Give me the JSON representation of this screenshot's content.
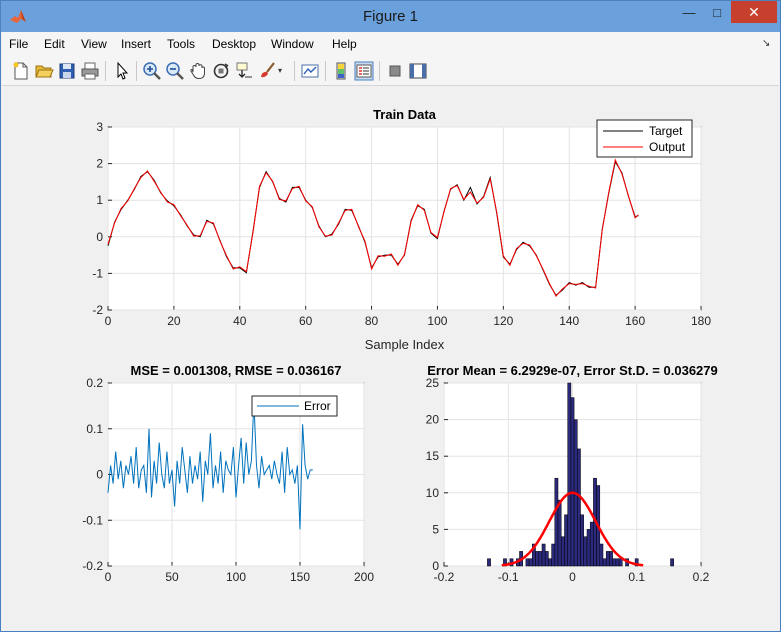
{
  "window": {
    "title": "Figure 1",
    "minimize": "—",
    "maximize": "□",
    "close": "✕"
  },
  "colors": {
    "titlebar": "#6aa0dc",
    "close": "#c7402e",
    "target": "#000000",
    "output": "#ff0000",
    "error": "#0072bd",
    "hist_bar": "#2b2a7d",
    "fit": "#ff0000"
  },
  "menu": [
    "File",
    "Edit",
    "View",
    "Insert",
    "Tools",
    "Desktop",
    "Window",
    "Help"
  ],
  "toolbar": [
    "new-figure-icon",
    "open-file-icon",
    "save-icon",
    "print-icon",
    "pointer-icon",
    "zoom-in-icon",
    "zoom-out-icon",
    "pan-icon",
    "rotate-3d-icon",
    "data-cursor-icon",
    "brush-icon",
    "link-plot-icon",
    "colorbar-icon",
    "legend-icon",
    "hide-plot-tools-icon",
    "show-plot-tools-icon"
  ],
  "chart_data": [
    {
      "type": "line",
      "title": "Train Data",
      "xlabel": "Sample Index",
      "ylabel": "",
      "xlim": [
        0,
        180
      ],
      "ylim": [
        -2,
        3
      ],
      "xticks": [
        "0",
        "20",
        "40",
        "60",
        "80",
        "100",
        "120",
        "140",
        "160",
        "180"
      ],
      "yticks": [
        "-2",
        "-1",
        "0",
        "1",
        "2",
        "3"
      ],
      "legend": {
        "placement": "top-right",
        "entries": [
          "Target",
          "Output"
        ]
      },
      "grid": true,
      "series": [
        {
          "name": "Target",
          "color": "#000000",
          "x": [
            0,
            2,
            4,
            6,
            8,
            10,
            12,
            14,
            16,
            18,
            20,
            22,
            24,
            26,
            28,
            30,
            32,
            34,
            36,
            38,
            40,
            42,
            44,
            46,
            48,
            50,
            52,
            54,
            56,
            58,
            60,
            62,
            64,
            66,
            68,
            70,
            72,
            74,
            76,
            78,
            80,
            82,
            84,
            86,
            88,
            90,
            92,
            94,
            96,
            98,
            100,
            102,
            104,
            106,
            108,
            110,
            112,
            114,
            116,
            118,
            120,
            122,
            124,
            126,
            128,
            130,
            132,
            134,
            136,
            138,
            140,
            142,
            144,
            146,
            148,
            150,
            152,
            154,
            156,
            158,
            160,
            161
          ],
          "y": [
            -0.25,
            0.4,
            0.75,
            1.0,
            1.3,
            1.65,
            1.78,
            1.55,
            1.2,
            0.98,
            0.85,
            0.6,
            0.3,
            0.05,
            0.0,
            0.45,
            0.35,
            -0.1,
            -0.55,
            -0.85,
            -0.85,
            -0.98,
            0.15,
            1.35,
            1.78,
            1.5,
            1.05,
            0.95,
            1.35,
            1.35,
            1.0,
            0.8,
            0.3,
            0.0,
            0.08,
            0.35,
            0.75,
            0.72,
            0.3,
            -0.15,
            -0.85,
            -0.55,
            -0.5,
            -0.5,
            -0.75,
            -0.5,
            0.45,
            0.85,
            0.75,
            0.1,
            -0.05,
            0.7,
            1.3,
            1.42,
            1.0,
            1.35,
            0.9,
            1.1,
            1.62,
            0.65,
            -0.55,
            -0.75,
            -0.35,
            -0.15,
            -0.25,
            -0.5,
            -0.9,
            -1.3,
            -1.6,
            -1.45,
            -1.25,
            -1.32,
            -1.25,
            -1.38,
            -1.38,
            0.2,
            1.2,
            2.05,
            1.75,
            1.1,
            0.55,
            0.58
          ]
        },
        {
          "name": "Output",
          "color": "#ff0000",
          "x": [
            0,
            2,
            4,
            6,
            8,
            10,
            12,
            14,
            16,
            18,
            20,
            22,
            24,
            26,
            28,
            30,
            32,
            34,
            36,
            38,
            40,
            42,
            44,
            46,
            48,
            50,
            52,
            54,
            56,
            58,
            60,
            62,
            64,
            66,
            68,
            70,
            72,
            74,
            76,
            78,
            80,
            82,
            84,
            86,
            88,
            90,
            92,
            94,
            96,
            98,
            100,
            102,
            104,
            106,
            108,
            110,
            112,
            114,
            116,
            118,
            120,
            122,
            124,
            126,
            128,
            130,
            132,
            134,
            136,
            138,
            140,
            142,
            144,
            146,
            148,
            150,
            152,
            154,
            156,
            158,
            160,
            161
          ],
          "y": [
            -0.2,
            0.38,
            0.78,
            0.98,
            1.32,
            1.62,
            1.8,
            1.52,
            1.22,
            0.95,
            0.88,
            0.58,
            0.32,
            0.02,
            0.03,
            0.42,
            0.38,
            -0.12,
            -0.52,
            -0.88,
            -0.82,
            -0.95,
            0.12,
            1.38,
            1.75,
            1.52,
            1.02,
            0.98,
            1.32,
            1.38,
            0.98,
            0.82,
            0.28,
            0.02,
            0.05,
            0.38,
            0.72,
            0.75,
            0.28,
            -0.12,
            -0.88,
            -0.52,
            -0.53,
            -0.47,
            -0.78,
            -0.48,
            0.42,
            0.88,
            0.72,
            0.12,
            -0.02,
            0.68,
            1.32,
            1.4,
            1.02,
            1.22,
            0.92,
            1.08,
            1.58,
            0.68,
            -0.52,
            -0.78,
            -0.32,
            -0.18,
            -0.22,
            -0.52,
            -0.88,
            -1.28,
            -1.62,
            -1.42,
            -1.28,
            -1.3,
            -1.28,
            -1.35,
            -1.4,
            0.18,
            1.22,
            2.1,
            1.72,
            1.12,
            0.52,
            0.6
          ]
        }
      ]
    },
    {
      "type": "line",
      "title": "MSE = 0.001308, RMSE = 0.036167",
      "xlabel": "",
      "ylabel": "",
      "xlim": [
        0,
        200
      ],
      "ylim": [
        -0.2,
        0.2
      ],
      "xticks": [
        "0",
        "50",
        "100",
        "150",
        "200"
      ],
      "yticks": [
        "-0.2",
        "-0.1",
        "0",
        "0.1",
        "0.2"
      ],
      "legend": {
        "placement": "top-right",
        "entries": [
          "Error"
        ]
      },
      "grid": true,
      "series": [
        {
          "name": "Error",
          "color": "#0072bd",
          "x": [
            0,
            2,
            4,
            6,
            8,
            10,
            12,
            14,
            16,
            18,
            20,
            22,
            24,
            26,
            28,
            30,
            32,
            34,
            36,
            38,
            40,
            42,
            44,
            46,
            48,
            50,
            52,
            54,
            56,
            58,
            60,
            62,
            64,
            66,
            68,
            70,
            72,
            74,
            76,
            78,
            80,
            82,
            84,
            86,
            88,
            90,
            92,
            94,
            96,
            98,
            100,
            102,
            104,
            106,
            108,
            110,
            112,
            114,
            116,
            118,
            120,
            122,
            124,
            126,
            128,
            130,
            132,
            134,
            136,
            138,
            140,
            142,
            144,
            146,
            148,
            150,
            152,
            154,
            156,
            158,
            160
          ],
          "y": [
            -0.04,
            0.02,
            -0.02,
            0.05,
            -0.01,
            0.03,
            -0.03,
            0.02,
            0.0,
            0.04,
            -0.02,
            0.06,
            -0.03,
            0.01,
            0.02,
            -0.04,
            0.1,
            -0.05,
            0.03,
            -0.02,
            0.07,
            0.0,
            -0.03,
            0.05,
            -0.02,
            0.01,
            -0.07,
            0.03,
            -0.02,
            0.06,
            0.01,
            -0.04,
            0.04,
            -0.02,
            0.02,
            -0.01,
            0.05,
            -0.06,
            0.03,
            0.0,
            0.09,
            -0.03,
            0.02,
            -0.02,
            0.05,
            -0.04,
            0.03,
            0.01,
            0.0,
            0.06,
            -0.05,
            0.02,
            0.08,
            -0.02,
            0.07,
            0.0,
            0.03,
            0.16,
            0.02,
            -0.03,
            0.04,
            0.0,
            0.01,
            0.02,
            -0.01,
            0.03,
            0.0,
            -0.02,
            0.05,
            -0.04,
            0.06,
            0.0,
            0.01,
            -0.02,
            0.02,
            -0.12,
            0.11,
            0.02,
            -0.01,
            0.01,
            0.01
          ]
        }
      ]
    },
    {
      "type": "bar",
      "title": "Error Mean = 6.2929e-07, Error St.D. = 0.036279",
      "xlabel": "",
      "ylabel": "",
      "xlim": [
        -0.2,
        0.2
      ],
      "ylim": [
        0,
        25
      ],
      "xticks": [
        "-0.2",
        "-0.1",
        "0",
        "0.1",
        "0.2"
      ],
      "yticks": [
        "0",
        "5",
        "10",
        "15",
        "20",
        "25"
      ],
      "grid": true,
      "bin_width": 0.005,
      "bin_centers": [
        -0.13,
        -0.105,
        -0.095,
        -0.085,
        -0.08,
        -0.07,
        -0.065,
        -0.06,
        -0.055,
        -0.05,
        -0.045,
        -0.04,
        -0.035,
        -0.03,
        -0.025,
        -0.02,
        -0.015,
        -0.01,
        -0.005,
        0.0,
        0.005,
        0.01,
        0.015,
        0.02,
        0.025,
        0.03,
        0.035,
        0.04,
        0.045,
        0.05,
        0.055,
        0.06,
        0.065,
        0.07,
        0.075,
        0.085,
        0.1,
        0.155
      ],
      "counts": [
        1,
        1,
        1,
        1,
        2,
        1,
        1,
        3,
        2,
        2,
        3,
        2,
        1,
        3,
        12,
        9,
        4,
        7,
        25,
        23,
        20,
        16,
        7,
        4,
        5,
        6,
        12,
        11,
        3,
        1,
        2,
        2,
        1,
        1,
        1,
        1,
        1,
        1
      ],
      "fit": {
        "type": "normal",
        "mean": 0.0,
        "std": 0.036279,
        "peak": 10,
        "color": "#ff0000"
      }
    }
  ]
}
